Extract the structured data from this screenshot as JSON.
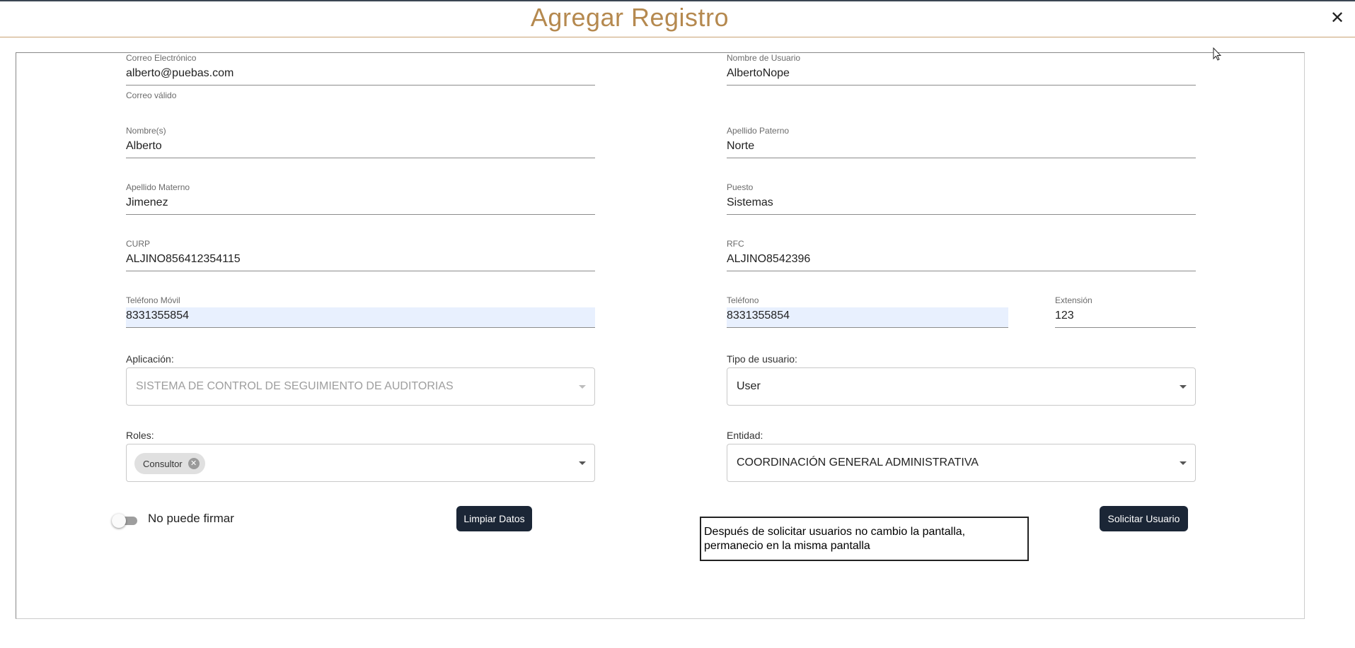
{
  "dialog": {
    "title": "Agregar Registro",
    "close_glyph": "✕"
  },
  "fields": {
    "email": {
      "label": "Correo Electrónico",
      "value": "alberto@puebas.com",
      "hint": "Correo válido"
    },
    "username": {
      "label": "Nombre de Usuario",
      "value": "AlbertoNope"
    },
    "first_name": {
      "label": "Nombre(s)",
      "value": "Alberto"
    },
    "paternal_surname": {
      "label": "Apellido Paterno",
      "value": "Norte"
    },
    "maternal_surname": {
      "label": "Apellido Materno",
      "value": "Jimenez"
    },
    "position": {
      "label": "Puesto",
      "value": "Sistemas"
    },
    "curp": {
      "label": "CURP",
      "value": "ALJINO856412354115"
    },
    "rfc": {
      "label": "RFC",
      "value": "ALJINO8542396"
    },
    "mobile_phone": {
      "label": "Teléfono Móvil",
      "value": "8331355854"
    },
    "phone": {
      "label": "Teléfono",
      "value": "8331355854"
    },
    "extension": {
      "label": "Extensión",
      "value": "123"
    }
  },
  "selects": {
    "application": {
      "label": "Aplicación:",
      "value": "SISTEMA DE CONTROL DE SEGUIMIENTO DE AUDITORIAS",
      "disabled": true
    },
    "user_type": {
      "label": "Tipo de usuario:",
      "value": "User"
    },
    "roles": {
      "label": "Roles:",
      "chips": [
        "Consultor"
      ]
    },
    "entity": {
      "label": "Entidad:",
      "value": "COORDINACIÓN GENERAL ADMINISTRATIVA"
    }
  },
  "toggle": {
    "label": "No puede firmar",
    "on": false
  },
  "buttons": {
    "clear": "Limpiar Datos",
    "request": "Solicitar Usuario"
  },
  "annotation": {
    "line1": "Después de solicitar  usuarios no cambio la pantalla,",
    "line2": "permanecio en la misma pantalla"
  },
  "colors": {
    "title": "#b5894f",
    "button_bg": "#1b2636",
    "autofill_bg": "#e8f0fe"
  },
  "icons": {
    "close": "close-icon",
    "dropdown": "chevron-down-icon",
    "chip_remove": "cancel-circle-icon",
    "cursor": "mouse-pointer-icon"
  }
}
